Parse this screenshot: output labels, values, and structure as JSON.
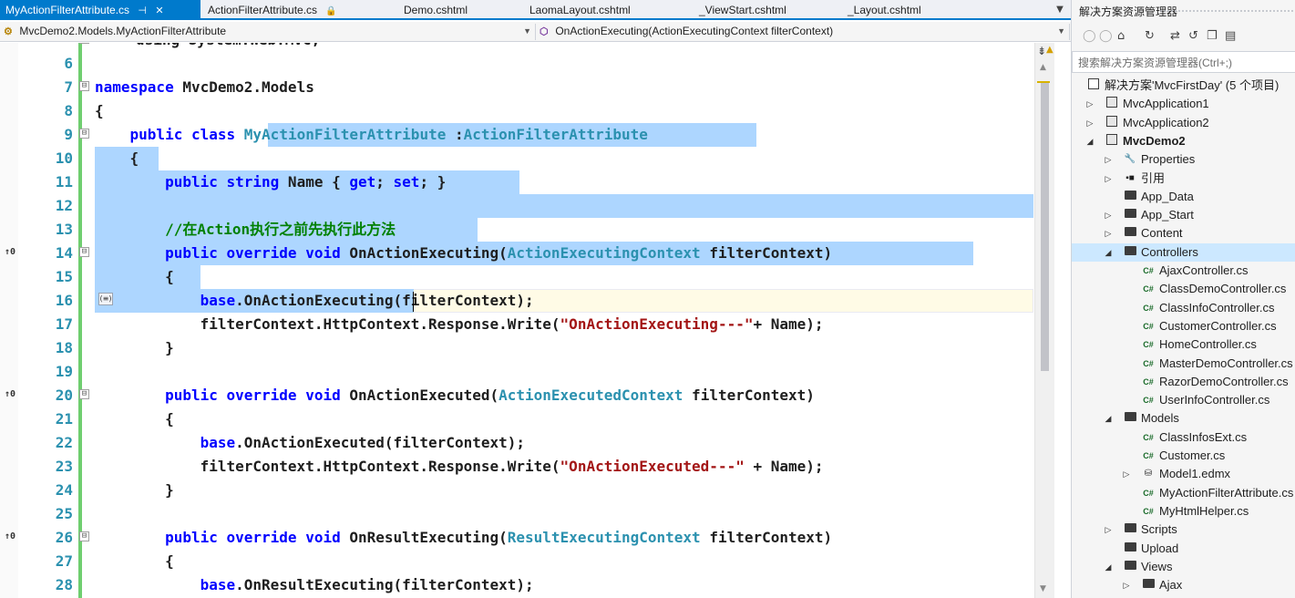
{
  "tabs": [
    {
      "label": "MyActionFilterAttribute.cs",
      "active": true,
      "pin": "⊣",
      "close": "✕"
    },
    {
      "label": "ActionFilterAttribute.cs",
      "locked": true,
      "lock": "🔒"
    },
    {
      "label": "Demo.cshtml"
    },
    {
      "label": "LaomaLayout.cshtml"
    },
    {
      "label": "_ViewStart.cshtml"
    },
    {
      "label": "_Layout.cshtml"
    }
  ],
  "tab_menu_glyph": "▼",
  "navbar": {
    "type_combo": "MvcDemo2.Models.MyActionFilterAttribute",
    "member_combo": "OnActionExecuting(ActionExecutingContext filterContext)"
  },
  "editor": {
    "partial_top_line": "using System.Web.Mvc;",
    "lines": [
      {
        "n": "6",
        "code": ""
      },
      {
        "n": "7",
        "code": "namespace MvcDemo2.Models"
      },
      {
        "n": "8",
        "code": "{"
      },
      {
        "n": "9",
        "code": "    public class MyActionFilterAttribute :ActionFilterAttribute"
      },
      {
        "n": "10",
        "code": "    {"
      },
      {
        "n": "11",
        "code": "        public string Name { get; set; }"
      },
      {
        "n": "12",
        "code": ""
      },
      {
        "n": "13",
        "code": "        //在Action执行之前先执行此方法"
      },
      {
        "n": "14",
        "code": "        public override void OnActionExecuting(ActionExecutingContext filterContext)"
      },
      {
        "n": "15",
        "code": "        {"
      },
      {
        "n": "16",
        "code": "            base.OnActionExecuting(filterContext);"
      },
      {
        "n": "17",
        "code": "            filterContext.HttpContext.Response.Write(\"OnActionExecuting---\"+ Name);"
      },
      {
        "n": "18",
        "code": "        }"
      },
      {
        "n": "19",
        "code": ""
      },
      {
        "n": "20",
        "code": "        public override void OnActionExecuted(ActionExecutedContext filterContext)"
      },
      {
        "n": "21",
        "code": "        {"
      },
      {
        "n": "22",
        "code": "            base.OnActionExecuted(filterContext);"
      },
      {
        "n": "23",
        "code": "            filterContext.HttpContext.Response.Write(\"OnActionExecuted---\" + Name);"
      },
      {
        "n": "24",
        "code": "        }"
      },
      {
        "n": "25",
        "code": ""
      },
      {
        "n": "26",
        "code": "        public override void OnResultExecuting(ResultExecutingContext filterContext)"
      },
      {
        "n": "27",
        "code": "        {"
      },
      {
        "n": "28",
        "code": "            base.OnResultExecuting(filterContext);"
      }
    ],
    "reference_marker": "↑0",
    "smart_tag": "(≡)"
  },
  "scrollbar": {
    "split": "⇟",
    "warning": "▲",
    "up": "▲",
    "down": "▼"
  },
  "solution_explorer": {
    "title": "解决方案资源管理器",
    "toolbar_icons": [
      "◯",
      "◯",
      "⌂",
      "↻",
      "⇄",
      "↺",
      "❐",
      "▤"
    ],
    "search_placeholder": "搜索解决方案资源管理器(Ctrl+;)",
    "tree": [
      {
        "label": "解决方案'MvcFirstDay' (5 个项目)",
        "kind": "solution",
        "depth": 0,
        "arrow": ""
      },
      {
        "label": "MvcApplication1",
        "kind": "project",
        "depth": 1,
        "arrow": "▷"
      },
      {
        "label": "MvcApplication2",
        "kind": "project",
        "depth": 1,
        "arrow": "▷"
      },
      {
        "label": "MvcDemo2",
        "kind": "project",
        "depth": 1,
        "arrow": "◢",
        "bold": true
      },
      {
        "label": "Properties",
        "kind": "properties",
        "depth": 2,
        "arrow": "▷"
      },
      {
        "label": "引用",
        "kind": "references",
        "depth": 2,
        "arrow": "▷"
      },
      {
        "label": "App_Data",
        "kind": "folder",
        "depth": 2,
        "arrow": ""
      },
      {
        "label": "App_Start",
        "kind": "folder",
        "depth": 2,
        "arrow": "▷"
      },
      {
        "label": "Content",
        "kind": "folder",
        "depth": 2,
        "arrow": "▷"
      },
      {
        "label": "Controllers",
        "kind": "folder",
        "depth": 2,
        "arrow": "◢",
        "selected": true
      },
      {
        "label": "AjaxController.cs",
        "kind": "cs",
        "depth": 3,
        "arrow": ""
      },
      {
        "label": "ClassDemoController.cs",
        "kind": "cs",
        "depth": 3,
        "arrow": ""
      },
      {
        "label": "ClassInfoController.cs",
        "kind": "cs",
        "depth": 3,
        "arrow": ""
      },
      {
        "label": "CustomerController.cs",
        "kind": "cs",
        "depth": 3,
        "arrow": ""
      },
      {
        "label": "HomeController.cs",
        "kind": "cs",
        "depth": 3,
        "arrow": ""
      },
      {
        "label": "MasterDemoController.cs",
        "kind": "cs",
        "depth": 3,
        "arrow": ""
      },
      {
        "label": "RazorDemoController.cs",
        "kind": "cs",
        "depth": 3,
        "arrow": ""
      },
      {
        "label": "UserInfoController.cs",
        "kind": "cs",
        "depth": 3,
        "arrow": ""
      },
      {
        "label": "Models",
        "kind": "folder",
        "depth": 2,
        "arrow": "◢"
      },
      {
        "label": "ClassInfosExt.cs",
        "kind": "cs",
        "depth": 3,
        "arrow": ""
      },
      {
        "label": "Customer.cs",
        "kind": "cs",
        "depth": 3,
        "arrow": ""
      },
      {
        "label": "Model1.edmx",
        "kind": "edmx",
        "depth": 3,
        "arrow": "▷"
      },
      {
        "label": "MyActionFilterAttribute.cs",
        "kind": "cs",
        "depth": 3,
        "arrow": ""
      },
      {
        "label": "MyHtmlHelper.cs",
        "kind": "cs",
        "depth": 3,
        "arrow": ""
      },
      {
        "label": "Scripts",
        "kind": "folder",
        "depth": 2,
        "arrow": "▷"
      },
      {
        "label": "Upload",
        "kind": "folder",
        "depth": 2,
        "arrow": ""
      },
      {
        "label": "Views",
        "kind": "folder",
        "depth": 2,
        "arrow": "◢"
      },
      {
        "label": "Ajax",
        "kind": "folder",
        "depth": 3,
        "arrow": "▷"
      }
    ]
  },
  "colors": {
    "accent": "#007acc",
    "selection": "#add6ff",
    "keyword": "#0000ff",
    "type": "#2b91af",
    "string": "#a31515",
    "comment": "#008000",
    "change_bar": "#6fce6f"
  }
}
